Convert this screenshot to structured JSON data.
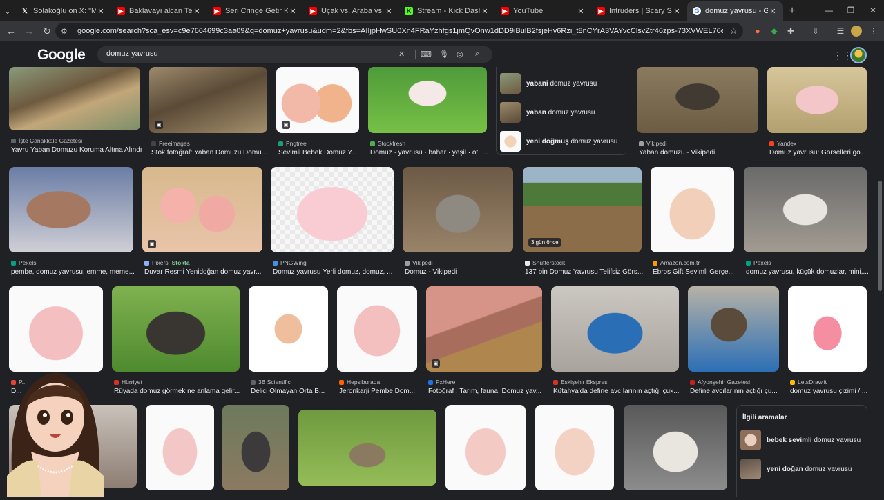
{
  "browser": {
    "tabs": [
      {
        "title": "Solakoğlu on X: \"Motorcu",
        "icon": "x-logo-icon",
        "color": "#000000"
      },
      {
        "title": "Baklavayı alcan Ters Çevir",
        "icon": "youtube-icon",
        "color": "#ff0000"
      },
      {
        "title": "Seri Cringe Getir Kardeşim",
        "icon": "youtube-icon",
        "color": "#ff0000"
      },
      {
        "title": "Uçak vs. Araba vs. Otobüs",
        "icon": "youtube-icon",
        "color": "#ff0000"
      },
      {
        "title": "Stream - Kick Dashboard",
        "icon": "kick-icon",
        "color": "#53fc18"
      },
      {
        "title": "YouTube",
        "icon": "youtube-icon",
        "color": "#ff0000"
      },
      {
        "title": "Intruders | Scary Short Ho",
        "icon": "youtube-icon",
        "color": "#ff0000"
      },
      {
        "title": "domuz yavrusu - Google",
        "icon": "google-icon",
        "color": "#4285f4",
        "active": true
      }
    ],
    "url": "google.com/search?sca_esv=c9e7664699c3aa09&q=domuz+yavrusu&udm=2&fbs=AIIjpHwSU0Xn4FRaYzhfgs1jmQvOnw1dDD9iBulB2fsjeHv6Rzi_t8nCYrA3VAYvcClsvZtr46zps-73XVWEL76eMkvwW0U2zSB5SEysBmVifJRHfC4ePRt..."
  },
  "google": {
    "logo": [
      "G",
      "o",
      "o",
      "g",
      "l",
      "e"
    ],
    "query": "domuz yavrusu"
  },
  "rows": [
    [
      {
        "source": "İşte Çanakkale Gazetesi",
        "caption": "Yavru Yaban Domuzu Koruma Altına Alındı",
        "src_color": "#5f6368",
        "img": "boar-piglet",
        "cam": false
      },
      {
        "source": "Freeimages",
        "caption": "Stok fotoğraf: Yaban Domuzu Domu...",
        "src_color": "#444444",
        "img": "boar-piglet-dark",
        "cam": true
      },
      {
        "source": "Pngtree",
        "caption": "Sevimli Bebek Domuz Y...",
        "src_color": "#1b9e77",
        "img": "two-piglets",
        "cam": true
      },
      {
        "source": "Stockfresh",
        "caption": "Domuz · yavrusu · bahar · yeşil · ot ·...",
        "src_color": "#4caf50",
        "img": "piglet-grass",
        "cam": false
      },
      {
        "source": "Vikipedi",
        "caption": "Yaban domuzu - Vikipedi",
        "src_color": "#9aa0a6",
        "img": "boar-mud",
        "cam": false
      },
      {
        "source": "Yandex",
        "caption": "Domuz yavrusu: Görselleri gö...",
        "src_color": "#fc3f1d",
        "img": "spotted-piglet",
        "cam": false
      }
    ],
    [
      {
        "source": "Pexels",
        "caption": "pembe, domuz yavrusu, emme, meme...",
        "src_color": "#05a081",
        "img": "sow-piglet",
        "cam": false
      },
      {
        "source": "Pixers",
        "caption": "Duvar Resmi Yenidoğan domuz yavr...",
        "src_color": "#8ab4f8",
        "img": "piglets-pile",
        "cam": true,
        "stokta": "Stokta"
      },
      {
        "source": "PNGWing",
        "caption": "Domuz yavrusu Yerli domuz, domuz, ...",
        "src_color": "#4a90e2",
        "img": "cartoon-pig",
        "cam": false
      },
      {
        "source": "Vikipedi",
        "caption": "Domuz - Vikipedi",
        "src_color": "#9aa0a6",
        "img": "grey-pig",
        "cam": false
      },
      {
        "source": "Shutterstock",
        "caption": "137 bin Domuz Yavrusu Telifsiz Görs...",
        "src_color": "#e8eaed",
        "img": "piglets-field",
        "cam": false,
        "badge": "3 gün önce"
      },
      {
        "source": "Amazon.com.tr",
        "caption": "Ebros Gift Sevimli Gerçe...",
        "src_color": "#ff9900",
        "img": "piglet-figure",
        "cam": false
      },
      {
        "source": "Pexels",
        "caption": "domuz yavrusu, küçük domuzlar, mini,...",
        "src_color": "#05a081",
        "img": "spotted-gravel",
        "cam": false
      }
    ],
    [
      {
        "source": "P...",
        "caption": "D...",
        "src_color": "#ea4335",
        "img": "pink-piglet",
        "cam": false
      },
      {
        "source": "Hürriyet",
        "caption": "Rüyada domuz görmek ne anlama gelir...",
        "src_color": "#d93025",
        "img": "black-boar",
        "cam": false
      },
      {
        "source": "3B Scientific",
        "caption": "Delici Olmayan Orta B...",
        "src_color": "#5f6368",
        "img": "pig-head",
        "cam": false
      },
      {
        "source": "Hepsiburada",
        "caption": "Jeronkarji Pembe Dom...",
        "src_color": "#ff6000",
        "img": "pink-plush",
        "cam": false
      },
      {
        "source": "PxHere",
        "caption": "Fotoğraf : Tarım, fauna, Domuz yav...",
        "src_color": "#1a73e8",
        "img": "nursing-piglets",
        "cam": true
      },
      {
        "source": "Eskişehir Ekspres",
        "caption": "Kütahya'da define avcılarının açtığı çuk...",
        "src_color": "#d93025",
        "img": "blue-hole",
        "cam": false
      },
      {
        "source": "Afyonşehir Gazetesi",
        "caption": "Define avcılarının açtığı çu...",
        "src_color": "#c5221f",
        "img": "boar-tarp",
        "cam": false
      },
      {
        "source": "LetsDraw.it",
        "caption": "domuz yavrusu çizimi / ...",
        "src_color": "#fbbc04",
        "img": "drawn-pig",
        "cam": false
      }
    ],
    [
      {
        "source": "",
        "caption": "",
        "img": "row4-a"
      },
      {
        "source": "",
        "caption": "",
        "img": "row4-b"
      },
      {
        "source": "",
        "caption": "",
        "img": "row4-c"
      },
      {
        "source": "",
        "caption": "",
        "img": "row4-d"
      },
      {
        "source": "",
        "caption": "",
        "img": "row4-e"
      },
      {
        "source": "",
        "caption": "",
        "img": "row4-f"
      },
      {
        "source": "",
        "caption": "",
        "img": "row4-g"
      }
    ]
  ],
  "related_top": [
    {
      "bold": "yabani",
      "rest": " domuz yavrusu"
    },
    {
      "bold": "yaban",
      "rest": " domuz yavrusu"
    },
    {
      "bold": "yeni doğmuş",
      "rest": " domuz yavrusu"
    }
  ],
  "related_bottom": {
    "heading": "İlgili aramalar",
    "items": [
      {
        "bold": "bebek sevimli",
        "rest": " domuz yavrusu"
      },
      {
        "bold": "yeni doğan",
        "rest": " domuz yavrusu"
      }
    ]
  }
}
